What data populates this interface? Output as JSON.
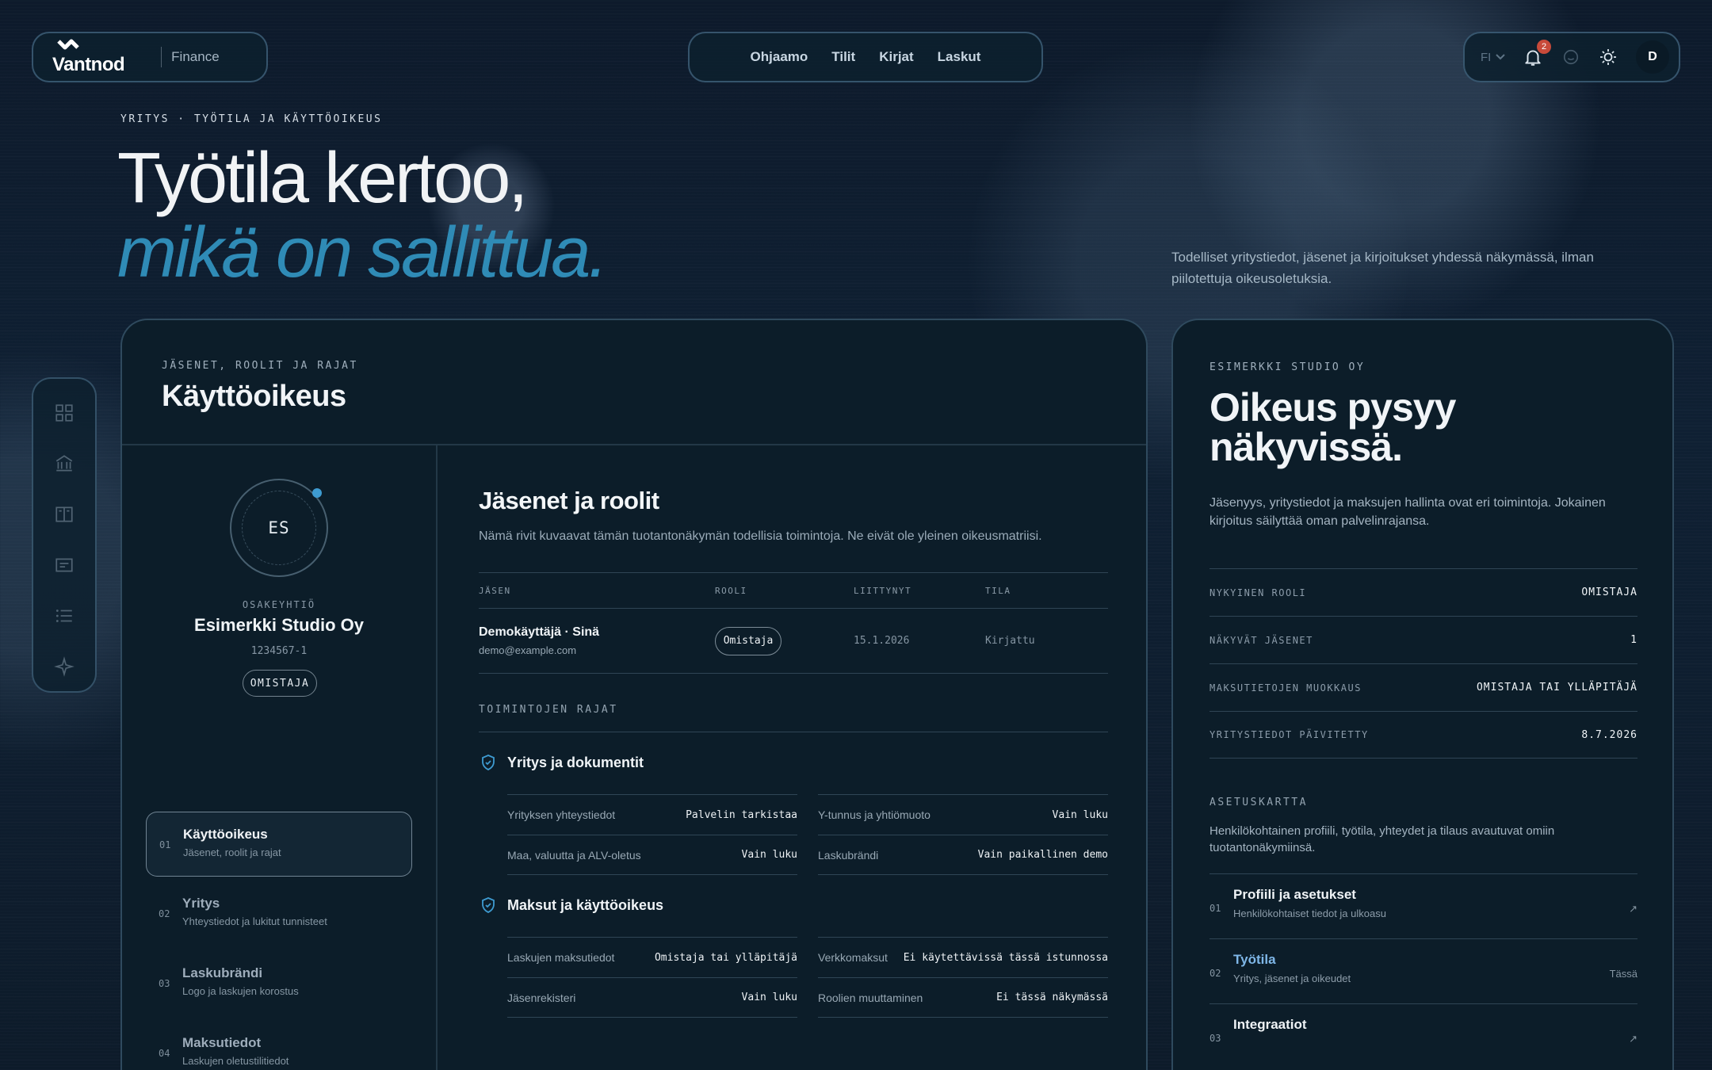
{
  "header": {
    "brand": "Vantnod",
    "product": "Finance",
    "nav": [
      "Ohjaamo",
      "Tilit",
      "Kirjat",
      "Laskut"
    ],
    "language": "FI",
    "notification_count": "2",
    "user_initial": "D"
  },
  "hero": {
    "breadcrumb": "YRITYS · TYÖTILA JA KÄYTTÖOIKEUS",
    "title_line1": "Työtila kertoo,",
    "title_line2": "mikä on sallittua.",
    "description": "Todelliset yritystiedot, jäsenet ja kirjoitukset yhdessä näkymässä, ilman piilotettuja oikeusoletuksia."
  },
  "main": {
    "eyebrow": "JÄSENET, ROOLIT JA RAJAT",
    "title": "Käyttöoikeus",
    "company": {
      "initials": "ES",
      "type": "OSAKEYHTIÖ",
      "name": "Esimerkki Studio Oy",
      "business_id": "1234567-1",
      "role": "OMISTAJA"
    },
    "menu": [
      {
        "num": "01",
        "title": "Käyttöoikeus",
        "sub": "Jäsenet, roolit ja rajat"
      },
      {
        "num": "02",
        "title": "Yritys",
        "sub": "Yhteystiedot ja lukitut tunnisteet"
      },
      {
        "num": "03",
        "title": "Laskubrändi",
        "sub": "Logo ja laskujen korostus"
      },
      {
        "num": "04",
        "title": "Maksutiedot",
        "sub": "Laskujen oletustilitiedot"
      }
    ],
    "members": {
      "title": "Jäsenet ja roolit",
      "description": "Nämä rivit kuvaavat tämän tuotantonäkymän todellisia toimintoja. Ne eivät ole yleinen oikeusmatriisi.",
      "columns": [
        "JÄSEN",
        "ROOLI",
        "LIITTYNYT",
        "TILA"
      ],
      "rows": [
        {
          "name": "Demokäyttäjä · Sinä",
          "email": "demo@example.com",
          "role": "Omistaja",
          "joined": "15.1.2026",
          "status": "Kirjattu"
        }
      ]
    },
    "limits": {
      "label": "TOIMINTOJEN RAJAT",
      "groups": [
        {
          "title": "Yritys ja dokumentit",
          "items": [
            {
              "k": "Yrityksen yhteystiedot",
              "v": "Palvelin tarkistaa"
            },
            {
              "k": "Y-tunnus ja yhtiömuoto",
              "v": "Vain luku"
            },
            {
              "k": "Maa, valuutta ja ALV-oletus",
              "v": "Vain luku"
            },
            {
              "k": "Laskubrändi",
              "v": "Vain paikallinen demo"
            }
          ]
        },
        {
          "title": "Maksut ja käyttöoikeus",
          "items": [
            {
              "k": "Laskujen maksutiedot",
              "v": "Omistaja tai ylläpitäjä"
            },
            {
              "k": "Verkkomaksut",
              "v": "Ei käytettävissä tässä istunnossa"
            },
            {
              "k": "Jäsenrekisteri",
              "v": "Vain luku"
            },
            {
              "k": "Roolien muuttaminen",
              "v": "Ei tässä näkymässä"
            }
          ]
        }
      ]
    }
  },
  "side": {
    "eyebrow": "ESIMERKKI STUDIO OY",
    "title_line1": "Oikeus pysyy",
    "title_line2": "näkyvissä.",
    "description": "Jäsenyys, yritystiedot ja maksujen hallinta ovat eri toimintoja. Jokainen kirjoitus säilyttää oman palvelinrajansa.",
    "facts": [
      {
        "k": "NYKYINEN ROOLI",
        "v": "OMISTAJA"
      },
      {
        "k": "NÄKYVÄT JÄSENET",
        "v": "1"
      },
      {
        "k": "MAKSUTIETOJEN MUOKKAUS",
        "v": "OMISTAJA TAI YLLÄPITÄJÄ"
      },
      {
        "k": "YRITYSTIEDOT PÄIVITETTY",
        "v": "8.7.2026"
      }
    ],
    "map_label": "ASETUSKARTTA",
    "map_description": "Henkilökohtainen profiili, työtila, yhteydet ja tilaus avautuvat omiin tuotantonäkymiinsä.",
    "map": [
      {
        "num": "01",
        "title": "Profiili ja asetukset",
        "sub": "Henkilökohtaiset tiedot ja ulkoasu",
        "tail": "↗"
      },
      {
        "num": "02",
        "title": "Työtila",
        "sub": "Yritys, jäsenet ja oikeudet",
        "tail": "Tässä"
      },
      {
        "num": "03",
        "title": "Integraatiot",
        "sub": "",
        "tail": "↗"
      }
    ]
  },
  "colors": {
    "accent": "#2f8bb6",
    "background": "#0d1a2b",
    "card": "#0c1d29",
    "notification": "#c84a3a"
  }
}
